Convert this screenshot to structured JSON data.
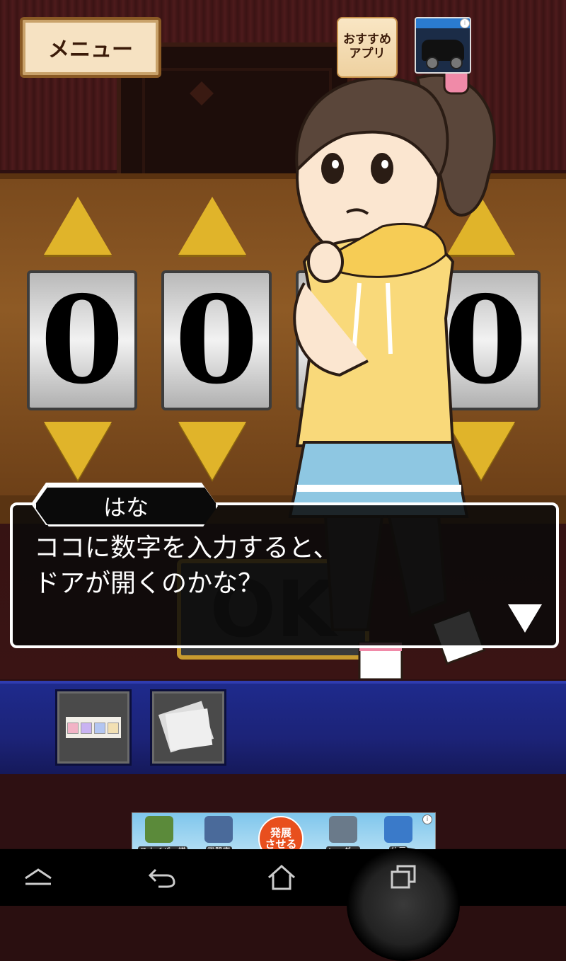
{
  "top_bar": {
    "menu_label": "メニュー",
    "recommended_apps_label": "おすすめ\nアプリ",
    "ad_icon": "car-ad-thumbnail",
    "ad_info_icon": "info-icon"
  },
  "lock": {
    "digits": [
      "0",
      "0",
      "0",
      "0"
    ],
    "up_icon": "triangle-up-icon",
    "down_icon": "triangle-down-icon",
    "ok_label": "OK"
  },
  "dialog": {
    "speaker": "はな",
    "text": "ココに数字を入力すると、\nドアが開くのかな？",
    "next_icon": "triangle-down-icon"
  },
  "inventory": {
    "items": [
      {
        "icon": "symbol-strip-paper-icon"
      },
      {
        "icon": "folded-paper-icon"
      }
    ]
  },
  "ad_banner": {
    "items": [
      "スナイパー塔",
      "武器庫",
      "レーダー",
      "住居"
    ],
    "cta": "発展\nさせる",
    "info_icon": "info-icon"
  },
  "nav_bar": {
    "icons": [
      "home-icon",
      "back-icon",
      "house-icon",
      "recent-apps-icon"
    ]
  }
}
